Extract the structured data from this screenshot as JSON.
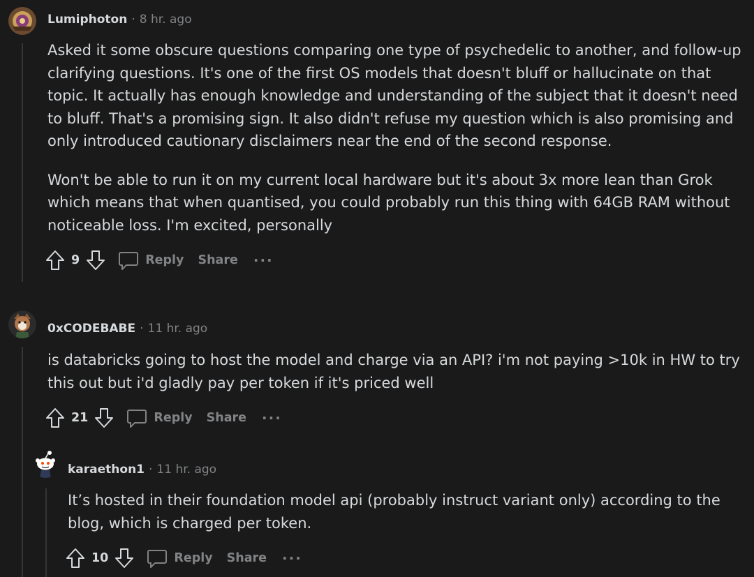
{
  "comments": [
    {
      "username": "Lumiphoton",
      "time": "8 hr. ago",
      "paragraphs": [
        "Asked it some obscure questions comparing one type of psychedelic to another, and follow-up clarifying questions. It's one of the first OS models that doesn't bluff or hallucinate on that topic. It actually has enough knowledge and understanding of the subject that it doesn't need to bluff. That's a promising sign. It also didn't refuse my question which is also promising and only introduced cautionary disclaimers near the end of the second response.",
        "Won't be able to run it on my current local hardware but it's about 3x more lean than Grok which means that when quantised, you could probably run this thing with 64GB RAM without noticeable loss. I'm excited, personally"
      ],
      "votes": "9",
      "reply": "Reply",
      "share": "Share",
      "more": "···"
    },
    {
      "username": "0xCODEBABE",
      "time": "11 hr. ago",
      "paragraphs": [
        "is databricks going to host the model and charge via an API? i'm not paying >10k in HW to try this out but i'd gladly pay per token if it's priced well"
      ],
      "votes": "21",
      "reply": "Reply",
      "share": "Share",
      "more": "···"
    },
    {
      "username": "karaethon1",
      "time": "11 hr. ago",
      "paragraphs": [
        "It’s hosted in their foundation model api (probably instruct variant only) according to the blog, which is charged per token."
      ],
      "votes": "10",
      "reply": "Reply",
      "share": "Share",
      "more": "···"
    }
  ],
  "separator": "·",
  "icons": {
    "upvote": "upvote-arrow-icon",
    "downvote": "downvote-arrow-icon",
    "reply": "speech-bubble-icon"
  }
}
